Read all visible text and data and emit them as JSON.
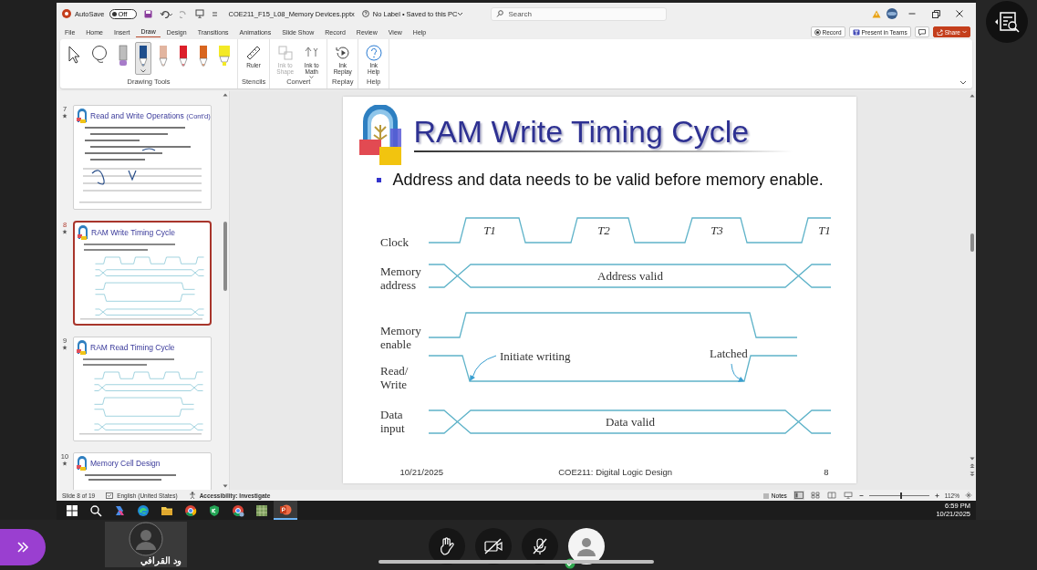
{
  "title_bar": {
    "autosave_label": "AutoSave",
    "autosave_toggle": {
      "label": "Off",
      "on": false
    },
    "file_name": "COE211_F15_L08_Memory Devices.pptx",
    "save_status": "No Label • Saved to this PC",
    "search": {
      "placeholder": "Search"
    }
  },
  "ribbon_tabs": [
    {
      "label": "File",
      "selected": false
    },
    {
      "label": "Home",
      "selected": false
    },
    {
      "label": "Insert",
      "selected": false
    },
    {
      "label": "Draw",
      "selected": true
    },
    {
      "label": "Design",
      "selected": false
    },
    {
      "label": "Transitions",
      "selected": false
    },
    {
      "label": "Animations",
      "selected": false
    },
    {
      "label": "Slide Show",
      "selected": false
    },
    {
      "label": "Record",
      "selected": false
    },
    {
      "label": "Review",
      "selected": false
    },
    {
      "label": "View",
      "selected": false
    },
    {
      "label": "Help",
      "selected": false
    }
  ],
  "ribbon_actions": [
    {
      "kind": "record",
      "label": "Record"
    },
    {
      "kind": "teams",
      "label": "Present in Teams"
    },
    {
      "kind": "comment"
    },
    {
      "kind": "share",
      "label": "Share"
    }
  ],
  "ribbon_groups": [
    {
      "label": "Drawing Tools",
      "tools": [
        {
          "kind": "select",
          "selected": false
        },
        {
          "kind": "lasso",
          "selected": false
        },
        {
          "kind": "eraser",
          "selected": false
        },
        {
          "kind": "pen",
          "color": "#1f4e8c",
          "selected": true
        },
        {
          "kind": "pen",
          "color": "#e2b5a0",
          "selected": false
        },
        {
          "kind": "pen",
          "color": "#dc1f2a",
          "selected": false
        },
        {
          "kind": "pen",
          "color": "#d8651f",
          "selected": false
        },
        {
          "kind": "highlighter",
          "color": "#f3e926",
          "selected": false
        }
      ]
    },
    {
      "label": "Stencils",
      "tools": [
        {
          "kind": "ruler",
          "label": "Ruler",
          "disabled": false
        }
      ]
    },
    {
      "label": "Convert",
      "tools": [
        {
          "kind": "ink-shape",
          "label": "Ink to Shape",
          "disabled": true
        },
        {
          "kind": "ink-math",
          "label": "Ink to Math",
          "disabled": false
        }
      ]
    },
    {
      "label": "Replay",
      "tools": [
        {
          "kind": "replay",
          "label": "Ink Replay",
          "disabled": false
        }
      ]
    },
    {
      "label": "Help",
      "tools": [
        {
          "kind": "help",
          "label": "Ink Help",
          "disabled": false
        }
      ]
    }
  ],
  "thumbnails": [
    {
      "number": "7",
      "title": "Read and Write Operations",
      "title_suffix": "(Cont'd)",
      "kind": "table",
      "selected": false
    },
    {
      "number": "8",
      "title": "RAM Write Timing Cycle",
      "kind": "timing",
      "selected": true
    },
    {
      "number": "9",
      "title": "RAM Read Timing Cycle",
      "kind": "timing",
      "selected": false
    },
    {
      "number": "10",
      "title": "Memory Cell Design",
      "kind": "text",
      "selected": false
    }
  ],
  "slide": {
    "title": "RAM Write Timing Cycle",
    "bullets": [
      "Address and data needs to be valid before memory enable."
    ],
    "timing_diagram": {
      "signals": [
        {
          "kind": "clock",
          "label": "Clock",
          "pulses": [
            "T1",
            "T2",
            "T3",
            "T1"
          ]
        },
        {
          "kind": "bus",
          "label": "Memory address",
          "value": "Address valid"
        },
        {
          "kind": "enable",
          "label": "Memory enable"
        },
        {
          "kind": "read_write",
          "label": "Read/ Write",
          "notes": [
            "Initiate writing",
            "Latched"
          ]
        },
        {
          "kind": "bus",
          "label": "Data input",
          "value": "Data valid"
        }
      ]
    },
    "footer": {
      "date": "10/21/2025",
      "course": "COE211: Digital Logic Design",
      "page": "8"
    }
  },
  "status_bar": {
    "slide_count": "Slide 8 of 19",
    "language": "English (United States)",
    "accessibility": "Accessibility: Investigate",
    "notes": "Notes",
    "views": [
      {
        "kind": "normal",
        "selected": true
      },
      {
        "kind": "sorter",
        "selected": false
      },
      {
        "kind": "reading",
        "selected": false
      },
      {
        "kind": "slideshow",
        "selected": false
      }
    ],
    "zoom": {
      "level": 0.52,
      "reading": "112%"
    }
  },
  "taskbar": {
    "apps": [
      {
        "kind": "start",
        "active": false
      },
      {
        "kind": "search",
        "active": false
      },
      {
        "kind": "copilot",
        "active": false
      },
      {
        "kind": "edge",
        "active": false
      },
      {
        "kind": "explorer",
        "active": false
      },
      {
        "kind": "chrome",
        "active": false
      },
      {
        "kind": "shield",
        "active": false
      },
      {
        "kind": "chrome-profile",
        "active": false
      },
      {
        "kind": "sheet",
        "active": false
      },
      {
        "kind": "powerpoint",
        "active": true
      }
    ],
    "time": "6:59 PM",
    "date": "10/21/2025"
  },
  "meeting": {
    "participant": {
      "name": "ود القرافي"
    },
    "controls": [
      {
        "kind": "raise-hand"
      },
      {
        "kind": "camera",
        "on": false
      },
      {
        "kind": "microphone",
        "on": false
      },
      {
        "kind": "profile"
      }
    ]
  }
}
